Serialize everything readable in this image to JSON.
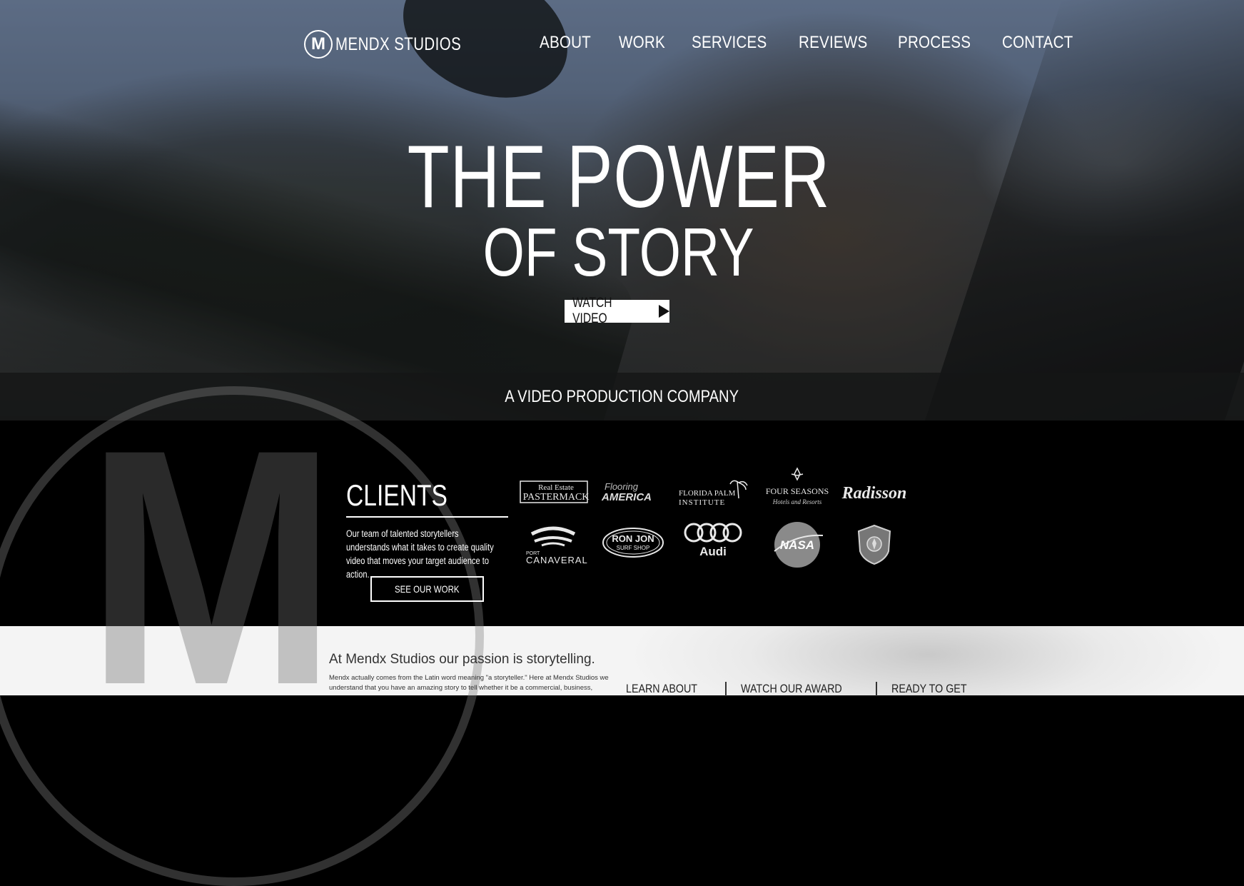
{
  "brand": {
    "name": "MENDX STUDIOS",
    "mark": "M"
  },
  "nav": [
    "ABOUT",
    "WORK",
    "SERVICES",
    "REVIEWS",
    "PROCESS",
    "CONTACT"
  ],
  "hero": {
    "title_line1": "THE POWER",
    "title_line2": "OF STORY",
    "watch_label": "WATCH VIDEO",
    "tagline": "A VIDEO PRODUCTION COMPANY"
  },
  "clients": {
    "heading": "CLIENTS",
    "description": "Our team of talented storytellers understands what it takes to create quality video that moves your target audience to action.",
    "button_label": "SEE OUR WORK",
    "logos": [
      {
        "name": "real-estate-pastermack",
        "line1": "Real Estate",
        "line2": "PASTERMACK"
      },
      {
        "name": "flooring-america",
        "line1": "Flooring",
        "line2": "AMERICA"
      },
      {
        "name": "florida-palm-institute",
        "line1": "FLORIDA PALM",
        "line2": "INSTITUTE"
      },
      {
        "name": "four-seasons",
        "line1": "FOUR SEASONS",
        "line2": "Hotels and Resorts"
      },
      {
        "name": "radisson",
        "line1": "Radisson",
        "line2": ""
      },
      {
        "name": "port-canaveral",
        "line1": "PORT",
        "line2": "CANAVERAL"
      },
      {
        "name": "ron-jon-surf-shop",
        "line1": "RON JON",
        "line2": "SURF SHOP"
      },
      {
        "name": "audi",
        "line1": "Audi",
        "line2": ""
      },
      {
        "name": "nasa",
        "line1": "NASA",
        "line2": ""
      },
      {
        "name": "police-badge",
        "line1": "",
        "line2": ""
      }
    ]
  },
  "about": {
    "heading": "At Mendx Studios our passion is storytelling.",
    "body": "Mendx actually comes from the Latin word meaning \"a storyteller.\" Here at Mendx Studios we understand that you have an amazing story to tell whether it be a commercial, business,",
    "links": [
      "LEARN ABOUT",
      "WATCH OUR AWARD",
      "READY TO GET"
    ]
  }
}
